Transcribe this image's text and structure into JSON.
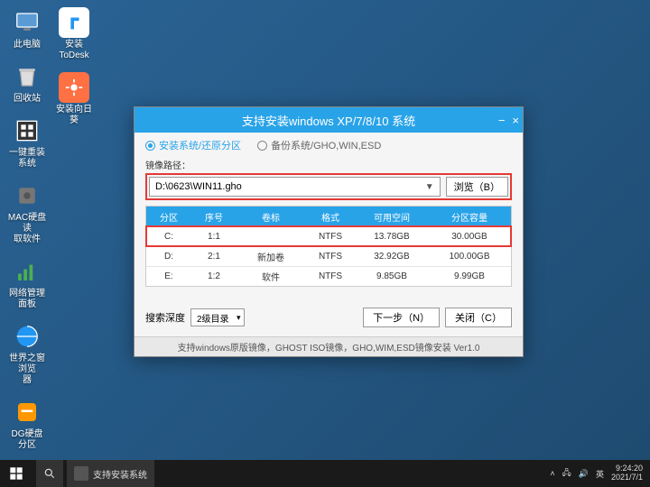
{
  "desktop": {
    "icons_col1": [
      {
        "name": "此电脑",
        "id": "this-pc"
      },
      {
        "name": "回收站",
        "id": "recycle-bin"
      },
      {
        "name": "一键重装系统",
        "id": "reinstall"
      },
      {
        "name": "MAC硬盘读\n取软件",
        "id": "mac-disk"
      },
      {
        "name": "网络管理面板",
        "id": "network-panel"
      },
      {
        "name": "世界之窗浏览\n器",
        "id": "theworld"
      },
      {
        "name": "DG硬盘分区",
        "id": "dg-partition"
      }
    ],
    "icons_col2": [
      {
        "name": "安装ToDesk",
        "id": "todesk"
      },
      {
        "name": "安装向日葵",
        "id": "sunflower"
      }
    ]
  },
  "window": {
    "title": "支持安装windows XP/7/8/10 系统",
    "min": "−",
    "close": "×",
    "mode1": "安装系统/还原分区",
    "mode2": "备份系统/GHO,WIN,ESD",
    "path_label": "镜像路径：",
    "path_value": "D:\\0623\\WIN11.gho",
    "browse": "浏览（B）",
    "columns": [
      "分区",
      "序号",
      "卷标",
      "格式",
      "可用空间",
      "分区容量"
    ],
    "rows": [
      {
        "c": [
          "C:",
          "1:1",
          "",
          "NTFS",
          "13.78GB",
          "30.00GB"
        ],
        "hl": true
      },
      {
        "c": [
          "D:",
          "2:1",
          "新加卷",
          "NTFS",
          "32.92GB",
          "100.00GB"
        ],
        "hl": false
      },
      {
        "c": [
          "E:",
          "1:2",
          "软件",
          "NTFS",
          "9.85GB",
          "9.99GB"
        ],
        "hl": false
      }
    ],
    "search_depth_label": "搜索深度",
    "search_depth_value": "2级目录",
    "next": "下一步（N）",
    "close_btn": "关闭（C）",
    "footer": "支持windows原版镜像，GHOST ISO镜像，GHO,WIM,ESD镜像安装 Ver1.0"
  },
  "taskbar": {
    "item1": "支持安装系统",
    "time": "9:24:20",
    "date": "2021/7/1"
  },
  "colors": {
    "accent": "#29a3e8",
    "highlight": "#e53935"
  }
}
